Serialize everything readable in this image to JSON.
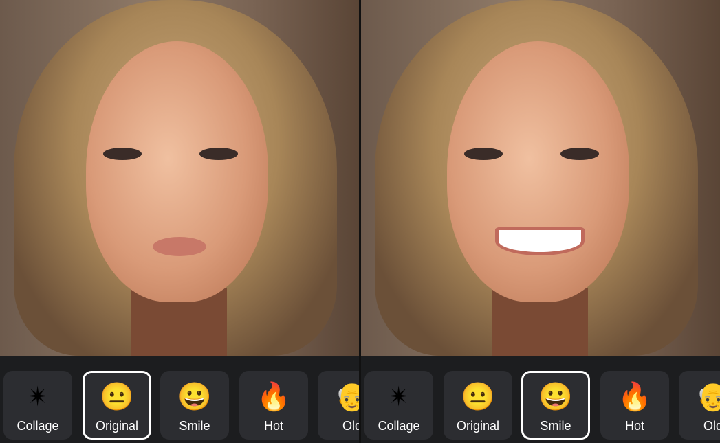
{
  "panels": [
    {
      "selected": "Original",
      "filters": [
        {
          "label": "Collage",
          "icon": "sparkle-star-icon",
          "glyph": "✴"
        },
        {
          "label": "Original",
          "icon": "neutral-face-icon",
          "glyph": "😐"
        },
        {
          "label": "Smile",
          "icon": "grinning-face-icon",
          "glyph": "😀"
        },
        {
          "label": "Hot",
          "icon": "fire-icon",
          "glyph": "🔥"
        },
        {
          "label": "Old",
          "icon": "old-man-icon",
          "glyph": "👴"
        }
      ]
    },
    {
      "selected": "Smile",
      "filters": [
        {
          "label": "Collage",
          "icon": "sparkle-star-icon",
          "glyph": "✴"
        },
        {
          "label": "Original",
          "icon": "neutral-face-icon",
          "glyph": "😐"
        },
        {
          "label": "Smile",
          "icon": "grinning-face-icon",
          "glyph": "😀"
        },
        {
          "label": "Hot",
          "icon": "fire-icon",
          "glyph": "🔥"
        },
        {
          "label": "Old",
          "icon": "old-man-icon",
          "glyph": "👴"
        }
      ]
    }
  ],
  "colors": {
    "bar_bg": "#1c1d1f",
    "tile_bg": "#2c2d31",
    "selected_border": "#ffffff"
  }
}
